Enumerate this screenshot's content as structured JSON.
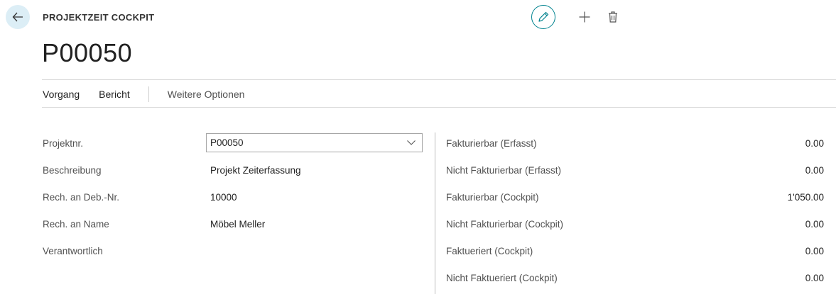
{
  "header": {
    "caption": "PROJEKTZEIT COCKPIT",
    "title": "P00050"
  },
  "menu": {
    "items": [
      "Vorgang",
      "Bericht"
    ],
    "more": "Weitere Optionen"
  },
  "general": {
    "projektnr_label": "Projektnr.",
    "projektnr_value": "P00050",
    "beschreibung_label": "Beschreibung",
    "beschreibung_value": "Projekt Zeiterfassung",
    "deb_nr_label": "Rech. an Deb.-Nr.",
    "deb_nr_value": "10000",
    "name_label": "Rech. an Name",
    "name_value": "Möbel Meller",
    "verantwortlich_label": "Verantwortlich",
    "verantwortlich_value": ""
  },
  "totals": [
    {
      "label": "Fakturierbar (Erfasst)",
      "value": "0.00"
    },
    {
      "label": "Nicht Fakturierbar (Erfasst)",
      "value": "0.00"
    },
    {
      "label": "Fakturierbar (Cockpit)",
      "value": "1'050.00"
    },
    {
      "label": "Nicht Fakturierbar (Cockpit)",
      "value": "0.00"
    },
    {
      "label": "Faktueriert (Cockpit)",
      "value": "0.00"
    },
    {
      "label": "Nicht Faktueriert (Cockpit)",
      "value": "0.00"
    }
  ],
  "icons": {
    "back": "arrow-left-icon",
    "edit": "pencil-icon",
    "new": "plus-icon",
    "delete": "trash-icon",
    "dropdown": "chevron-down-icon"
  },
  "colors": {
    "accent": "#00838f",
    "back_button_bg": "#dceef6"
  }
}
